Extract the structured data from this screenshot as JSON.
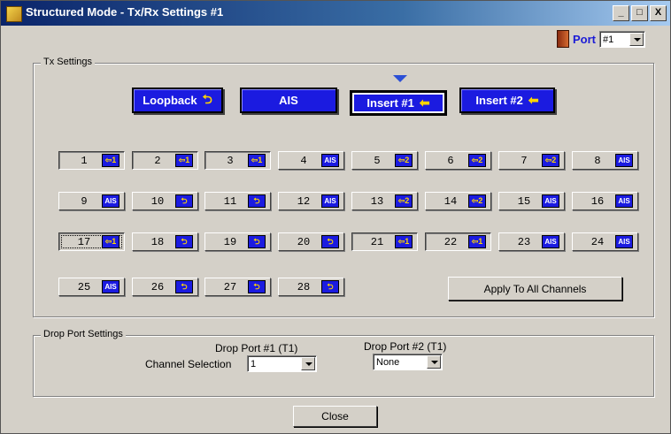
{
  "window": {
    "title": "Structured Mode - Tx/Rx Settings #1",
    "title_buttons": [
      "_",
      "□",
      "X"
    ]
  },
  "port": {
    "label": "Port",
    "value": "#1"
  },
  "tx_settings": {
    "title": "Tx Settings",
    "selected_mode": "Insert #1",
    "modes": [
      {
        "label": "Loopback",
        "icon": "loopback-icon",
        "glyph": "⮌"
      },
      {
        "label": "AIS",
        "icon": "",
        "glyph": ""
      },
      {
        "label": "Insert #1",
        "icon": "arrow-left-icon",
        "glyph": "⬅"
      },
      {
        "label": "Insert #2",
        "icon": "arrow-left-icon",
        "glyph": "⬅"
      }
    ],
    "channels": [
      {
        "num": "1",
        "icon": "⇦1",
        "kind": "insert",
        "state": "sunk"
      },
      {
        "num": "2",
        "icon": "⇦1",
        "kind": "insert",
        "state": "sunk"
      },
      {
        "num": "3",
        "icon": "⇦1",
        "kind": "insert",
        "state": "sunk"
      },
      {
        "num": "4",
        "icon": "AIS",
        "kind": "ais",
        "state": ""
      },
      {
        "num": "5",
        "icon": "⇦2",
        "kind": "insert",
        "state": ""
      },
      {
        "num": "6",
        "icon": "⇦2",
        "kind": "insert",
        "state": ""
      },
      {
        "num": "7",
        "icon": "⇦2",
        "kind": "insert",
        "state": ""
      },
      {
        "num": "8",
        "icon": "AIS",
        "kind": "ais",
        "state": ""
      },
      {
        "num": "9",
        "icon": "AIS",
        "kind": "ais",
        "state": ""
      },
      {
        "num": "10",
        "icon": "⮌",
        "kind": "loop",
        "state": ""
      },
      {
        "num": "11",
        "icon": "⮌",
        "kind": "loop",
        "state": ""
      },
      {
        "num": "12",
        "icon": "AIS",
        "kind": "ais",
        "state": ""
      },
      {
        "num": "13",
        "icon": "⇦2",
        "kind": "insert",
        "state": ""
      },
      {
        "num": "14",
        "icon": "⇦2",
        "kind": "insert",
        "state": ""
      },
      {
        "num": "15",
        "icon": "AIS",
        "kind": "ais",
        "state": ""
      },
      {
        "num": "16",
        "icon": "AIS",
        "kind": "ais",
        "state": ""
      },
      {
        "num": "17",
        "icon": "⇦1",
        "kind": "insert",
        "state": "sunk sel"
      },
      {
        "num": "18",
        "icon": "⮌",
        "kind": "loop",
        "state": ""
      },
      {
        "num": "19",
        "icon": "⮌",
        "kind": "loop",
        "state": ""
      },
      {
        "num": "20",
        "icon": "⮌",
        "kind": "loop",
        "state": ""
      },
      {
        "num": "21",
        "icon": "⇦1",
        "kind": "insert",
        "state": "sunk"
      },
      {
        "num": "22",
        "icon": "⇦1",
        "kind": "insert",
        "state": "sunk"
      },
      {
        "num": "23",
        "icon": "AIS",
        "kind": "ais",
        "state": ""
      },
      {
        "num": "24",
        "icon": "AIS",
        "kind": "ais",
        "state": ""
      },
      {
        "num": "25",
        "icon": "AIS",
        "kind": "ais",
        "state": ""
      },
      {
        "num": "26",
        "icon": "⮌",
        "kind": "loop",
        "state": ""
      },
      {
        "num": "27",
        "icon": "⮌",
        "kind": "loop",
        "state": ""
      },
      {
        "num": "28",
        "icon": "⮌",
        "kind": "loop",
        "state": ""
      }
    ],
    "apply_label": "Apply To All Channels"
  },
  "drop_port": {
    "title": "Drop Port Settings",
    "channel_selection_label": "Channel Selection",
    "port1_label": "Drop Port #1 (T1)",
    "port1_value": "1",
    "port2_label": "Drop Port #2 (T1)",
    "port2_value": "None"
  },
  "close_label": "Close",
  "colors": {
    "mode_button": "#1b1be0",
    "icon_yellow": "#ffd500",
    "port_label": "#1b1bd6"
  }
}
